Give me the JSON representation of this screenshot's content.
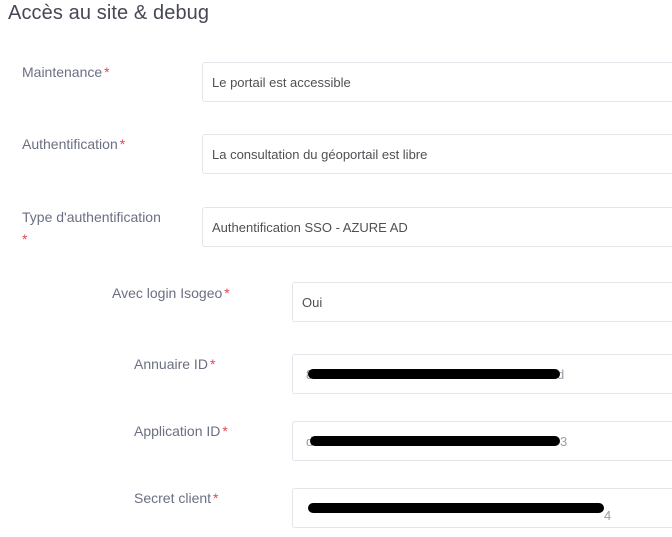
{
  "page": {
    "title": "Accès au site & debug"
  },
  "fields": {
    "maintenance": {
      "label": "Maintenance",
      "required_mark": "*",
      "value": "Le portail est accessible"
    },
    "authentification": {
      "label": "Authentification",
      "required_mark": "*",
      "value": "La consultation du géoportail est libre"
    },
    "type_authentification": {
      "label": "Type d'authentification",
      "required_mark": "*",
      "value": "Authentification SSO - AZURE AD"
    },
    "avec_login_isogeo": {
      "label": "Avec login Isogeo",
      "required_mark": "*",
      "value": "Oui"
    },
    "annuaire_id": {
      "label": "Annuaire ID",
      "required_mark": "*",
      "value_start": "8",
      "value_end": "d",
      "redacted": true
    },
    "application_id": {
      "label": "Application ID",
      "required_mark": "*",
      "value_start": "d",
      "value_end": "3",
      "redacted": true
    },
    "secret_client": {
      "label": "Secret client",
      "required_mark": "*",
      "value_start": "",
      "value_end": "4",
      "redacted": true
    }
  },
  "colors": {
    "required": "#e0475a",
    "label": "#6b6f82",
    "title": "#464855",
    "border": "#e3e5ea"
  }
}
